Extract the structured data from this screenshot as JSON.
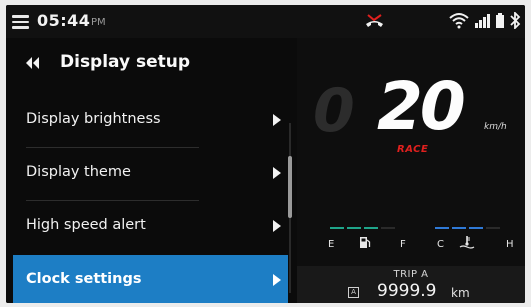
{
  "status": {
    "time": "05:44",
    "ampm": "PM"
  },
  "menu": {
    "title": "Display setup",
    "items": [
      {
        "label": "Display brightness",
        "active": false
      },
      {
        "label": "Display theme",
        "active": false
      },
      {
        "label": "High speed alert",
        "active": false
      },
      {
        "label": "Clock settings",
        "active": true
      }
    ]
  },
  "dash": {
    "speed": "20",
    "speed_unit": "km/h",
    "ride_mode": "RACE",
    "fuel_labels": [
      "E",
      "F"
    ],
    "temp_labels": [
      "C",
      "H"
    ],
    "trip_label": "TRIP A",
    "trip_badge": "A",
    "trip_value": "9999.9",
    "trip_unit": "km",
    "colors": {
      "accent": "#1d7ec5",
      "mode": "#e0201e",
      "fuel": "#1fa58a",
      "temp": "#2f79d6"
    }
  },
  "icons": [
    "menu-icon",
    "bluetooth-icon",
    "battery-icon",
    "signal-icon",
    "wifi-icon",
    "missed-call-icon",
    "back-icon",
    "chevron-right-icon",
    "fuel-icon",
    "coolant-icon"
  ]
}
